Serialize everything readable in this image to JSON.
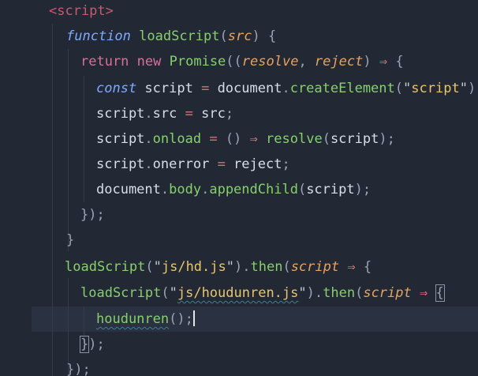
{
  "editor": {
    "lines": [
      {
        "tokens": [
          {
            "t": "<script>",
            "c": "tag"
          }
        ]
      },
      {
        "tokens": [
          {
            "t": "function",
            "c": "kw"
          },
          {
            "t": " ",
            "c": "id"
          },
          {
            "t": "loadScript",
            "c": "fn"
          },
          {
            "t": "(",
            "c": "punc"
          },
          {
            "t": "src",
            "c": "param"
          },
          {
            "t": ") {",
            "c": "punc"
          }
        ]
      },
      {
        "tokens": [
          {
            "t": "return",
            "c": "kw2"
          },
          {
            "t": " ",
            "c": "id"
          },
          {
            "t": "new",
            "c": "kw2"
          },
          {
            "t": " ",
            "c": "id"
          },
          {
            "t": "Promise",
            "c": "fn"
          },
          {
            "t": "((",
            "c": "punc"
          },
          {
            "t": "resolve",
            "c": "param"
          },
          {
            "t": ", ",
            "c": "punc"
          },
          {
            "t": "reject",
            "c": "param"
          },
          {
            "t": ") ",
            "c": "punc"
          },
          {
            "t": "⇒",
            "c": "op"
          },
          {
            "t": " {",
            "c": "punc"
          }
        ]
      },
      {
        "tokens": [
          {
            "t": "const",
            "c": "kw"
          },
          {
            "t": " script ",
            "c": "id"
          },
          {
            "t": "=",
            "c": "op"
          },
          {
            "t": " document",
            "c": "id"
          },
          {
            "t": ".",
            "c": "punc"
          },
          {
            "t": "createElement",
            "c": "fn"
          },
          {
            "t": "(",
            "c": "punc"
          },
          {
            "t": "\"",
            "c": "strq"
          },
          {
            "t": "script",
            "c": "str"
          },
          {
            "t": "\"",
            "c": "strq"
          },
          {
            "t": ");",
            "c": "punc"
          }
        ]
      },
      {
        "tokens": [
          {
            "t": "script",
            "c": "id"
          },
          {
            "t": ".",
            "c": "punc"
          },
          {
            "t": "src",
            "c": "prop"
          },
          {
            "t": " = ",
            "c": "op"
          },
          {
            "t": "src",
            "c": "id"
          },
          {
            "t": ";",
            "c": "punc"
          }
        ]
      },
      {
        "tokens": [
          {
            "t": "script",
            "c": "id"
          },
          {
            "t": ".",
            "c": "punc"
          },
          {
            "t": "onload",
            "c": "fn"
          },
          {
            "t": " = ",
            "c": "op"
          },
          {
            "t": "() ",
            "c": "punc"
          },
          {
            "t": "⇒",
            "c": "op"
          },
          {
            "t": " ",
            "c": "id"
          },
          {
            "t": "resolve",
            "c": "fn"
          },
          {
            "t": "(",
            "c": "punc"
          },
          {
            "t": "script",
            "c": "id"
          },
          {
            "t": ");",
            "c": "punc"
          }
        ]
      },
      {
        "tokens": [
          {
            "t": "script",
            "c": "id"
          },
          {
            "t": ".",
            "c": "punc"
          },
          {
            "t": "onerror",
            "c": "prop"
          },
          {
            "t": " = ",
            "c": "op"
          },
          {
            "t": "reject",
            "c": "id"
          },
          {
            "t": ";",
            "c": "punc"
          }
        ]
      },
      {
        "tokens": [
          {
            "t": "document",
            "c": "id"
          },
          {
            "t": ".",
            "c": "punc"
          },
          {
            "t": "body",
            "c": "fn"
          },
          {
            "t": ".",
            "c": "punc"
          },
          {
            "t": "appendChild",
            "c": "fn"
          },
          {
            "t": "(",
            "c": "punc"
          },
          {
            "t": "script",
            "c": "id"
          },
          {
            "t": ");",
            "c": "punc"
          }
        ]
      },
      {
        "tokens": [
          {
            "t": "});",
            "c": "punc"
          }
        ]
      },
      {
        "tokens": [
          {
            "t": "}",
            "c": "punc"
          }
        ]
      },
      {
        "tokens": [
          {
            "t": "loadScript",
            "c": "fn"
          },
          {
            "t": "(",
            "c": "punc"
          },
          {
            "t": "\"",
            "c": "strq"
          },
          {
            "t": "js/hd.js",
            "c": "str"
          },
          {
            "t": "\"",
            "c": "strq"
          },
          {
            "t": ").",
            "c": "punc"
          },
          {
            "t": "then",
            "c": "fn"
          },
          {
            "t": "(",
            "c": "punc"
          },
          {
            "t": "script",
            "c": "param"
          },
          {
            "t": " ",
            "c": "id"
          },
          {
            "t": "⇒",
            "c": "op"
          },
          {
            "t": " {",
            "c": "punc"
          }
        ]
      },
      {
        "tokens": [
          {
            "t": "loadScript",
            "c": "fn"
          },
          {
            "t": "(",
            "c": "punc"
          },
          {
            "t": "\"",
            "c": "strq"
          },
          {
            "t": "js/houdunren.js",
            "c": "str squig"
          },
          {
            "t": "\"",
            "c": "strq"
          },
          {
            "t": ").",
            "c": "punc"
          },
          {
            "t": "then",
            "c": "fn"
          },
          {
            "t": "(",
            "c": "punc"
          },
          {
            "t": "script",
            "c": "param"
          },
          {
            "t": " ",
            "c": "id"
          },
          {
            "t": "⇒",
            "c": "op"
          },
          {
            "t": " ",
            "c": "id"
          },
          {
            "t": "{",
            "c": "punc bracket-box"
          }
        ]
      },
      {
        "tokens": [
          {
            "t": "houdunren",
            "c": "fn squig"
          },
          {
            "t": "();",
            "c": "punc"
          }
        ],
        "cursor": true
      },
      {
        "tokens": [
          {
            "t": "}",
            "c": "punc bracket-box"
          },
          {
            "t": ");",
            "c": "punc"
          }
        ]
      },
      {
        "tokens": [
          {
            "t": "});",
            "c": "punc"
          }
        ]
      }
    ]
  }
}
